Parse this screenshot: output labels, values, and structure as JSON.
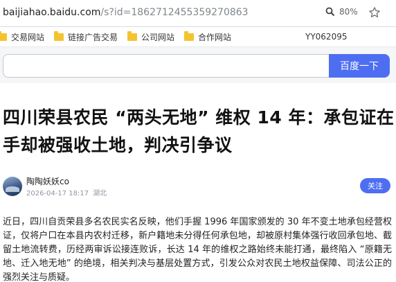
{
  "browser": {
    "url_host": "baijiahao.baidu.com",
    "url_path": "/s?id=1862712455359270863",
    "zoom": "80%",
    "zoom_icon": "magnifier-icon",
    "star_icon": "star-icon"
  },
  "bookmarks": [
    {
      "label": "交易网站",
      "icon": "folder-icon"
    },
    {
      "label": "链接广告交易",
      "icon": "folder-icon"
    },
    {
      "label": "公司网站",
      "icon": "folder-icon"
    },
    {
      "label": "合作网站",
      "icon": "folder-icon"
    }
  ],
  "bookmark_code": "YY062095",
  "search": {
    "value": "",
    "placeholder": "",
    "button_label": "百度一下"
  },
  "article": {
    "title": "四川荣县农民 “两头无地” 维权 14 年：承包证在手却被强收土地，判决引争议",
    "author": "陶陶妖妖co",
    "date": "2026-04-17 18:17",
    "location": "湖北",
    "follow_label": "关注",
    "body": "近日，四川自贡荣县多名农民实名反映，他们手握 1996 年国家颁发的 30 年不变土地承包经营权证，仅将户口在本县内农村迁移，新户籍地未分得任何承包地，却被原村集体强行收回承包地、截留土地流转费，历经两审诉讼接连败诉，长达 14 年的维权之路始终未能打通，最终陷入 “原籍无地、迁入地无地” 的绝境，相关判决与基层处置方式，引发公众对农民土地权益保障、司法公正的强烈关注与质疑。"
  },
  "colors": {
    "accent": "#4e6ef2",
    "folder": "#f4c430",
    "meta": "#9195a3"
  }
}
